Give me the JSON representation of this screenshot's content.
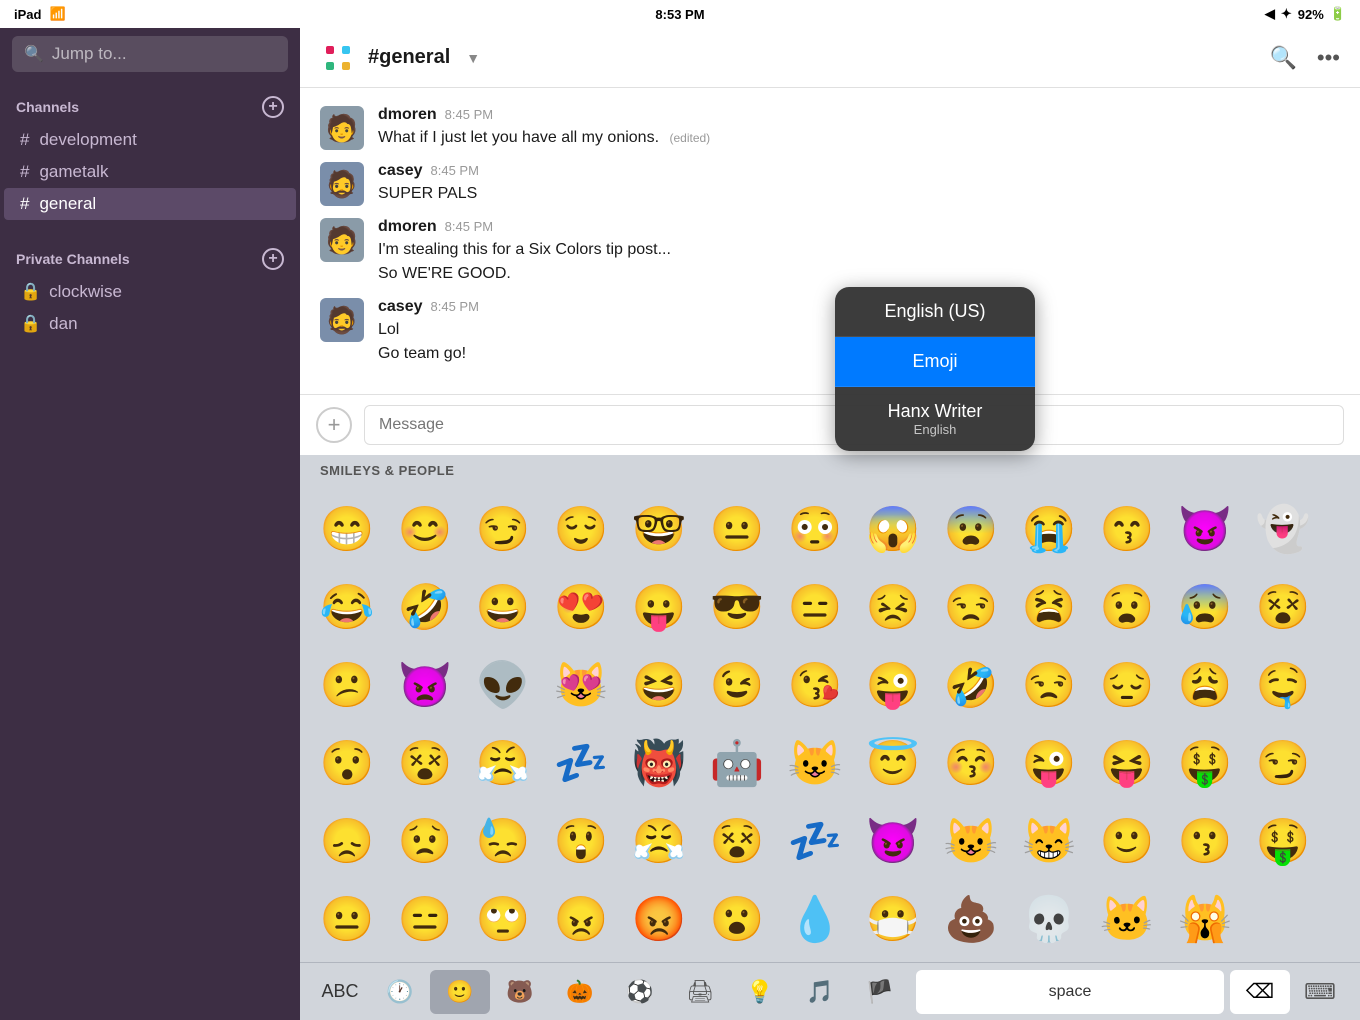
{
  "statusBar": {
    "left": "iPad ✦ WiFi",
    "time": "8:53 PM",
    "rightItems": [
      "▶",
      "✦",
      "92%"
    ]
  },
  "sidebar": {
    "searchPlaceholder": "Jump to...",
    "channelsLabel": "Channels",
    "channels": [
      {
        "name": "development",
        "type": "hash"
      },
      {
        "name": "gametalk",
        "type": "hash"
      },
      {
        "name": "general",
        "type": "hash",
        "active": true
      }
    ],
    "privateChannelsLabel": "Private Channels",
    "privateChannels": [
      {
        "name": "clockwise",
        "type": "lock"
      },
      {
        "name": "dan",
        "type": "lock"
      }
    ]
  },
  "chat": {
    "channelName": "#general",
    "messages": [
      {
        "id": 1,
        "author": "dmoren",
        "time": "8:45 PM",
        "text": "What if I just let you have all my onions.",
        "edited": true,
        "avatarEmoji": "🧑"
      },
      {
        "id": 2,
        "author": "casey",
        "time": "8:45 PM",
        "text": "SUPER PALS",
        "edited": false,
        "avatarEmoji": "🧔"
      },
      {
        "id": 3,
        "author": "dmoren",
        "time": "8:45 PM",
        "textLines": [
          "I'm stealing this for a Six Colors tip post...",
          "So WE'RE GOOD."
        ],
        "edited": false,
        "avatarEmoji": "🧑"
      },
      {
        "id": 4,
        "author": "casey",
        "time": "8:45 PM",
        "textLines": [
          "Lol",
          "Go team go!"
        ],
        "edited": false,
        "avatarEmoji": "🧔"
      }
    ],
    "inputPlaceholder": "Message"
  },
  "emojiKeyboard": {
    "categoryLabel": "SMILEYS & PEOPLE",
    "emojis": [
      "😁",
      "😊",
      "😏",
      "😌",
      "🤓",
      "😐",
      "😳",
      "😱",
      "😨",
      "😭",
      "😙",
      "😈",
      "👻",
      "😂",
      "🤣",
      "😀",
      "😍",
      "😛",
      "😎",
      "😑",
      "😣",
      "😒",
      "😫",
      "😧",
      "😰",
      "😵",
      "😕",
      "👿",
      "👽",
      "😻",
      "😆",
      "😉",
      "😘",
      "😜",
      "🤣",
      "😒",
      "😔",
      "😩",
      "🤤",
      "😯",
      "😵",
      "😤",
      "💤",
      "👹",
      "🤖",
      "😺",
      "😇",
      "😚",
      "😜",
      "😝",
      "🤑",
      "😏",
      "😞",
      "😟",
      "😓",
      "😲",
      "😤",
      "😵",
      "💤",
      "😈",
      "😺",
      "😸",
      "🙂",
      "😗",
      "🤑",
      "😐",
      "😑",
      "🙄",
      "😠",
      "😡",
      "😮",
      "💧",
      "😷",
      "💩",
      "💀",
      "🐱",
      "🙀"
    ],
    "toolbar": {
      "abc": "ABC",
      "icons": [
        "🕐",
        "🙂",
        "🐻",
        "🎃",
        "⚽",
        "🖨",
        "💡",
        "🎵",
        "🏴"
      ],
      "spaceLabel": "space",
      "deleteLabel": "⌫",
      "keyboardLabel": "⌨"
    }
  },
  "languageDropdown": {
    "options": [
      {
        "label": "English (US)",
        "sublabel": null,
        "selected": false
      },
      {
        "label": "Emoji",
        "sublabel": null,
        "selected": true
      },
      {
        "label": "Hanx Writer",
        "sublabel": "English",
        "selected": false
      }
    ]
  }
}
